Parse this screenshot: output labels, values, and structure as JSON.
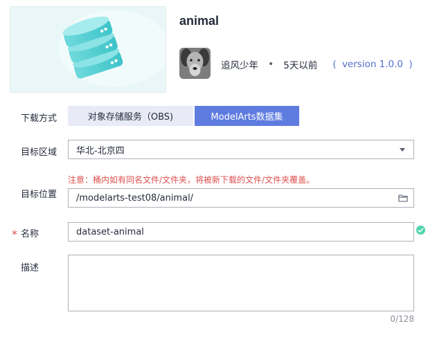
{
  "dataset": {
    "title": "animal",
    "author": "追风少年",
    "separator": "•",
    "time_ago": "5天以前",
    "version_open": "(",
    "version": "version 1.0.0",
    "version_close": ")"
  },
  "form": {
    "download_label": "下载方式",
    "download_options": [
      "对象存储服务（OBS)",
      "ModelArts数据集"
    ],
    "selected_option": "ModelArts数据集",
    "region_label": "目标区域",
    "region_value": "华北-北京四",
    "location_label": "目标位置",
    "warning": "注意：桶内如有同名文件/文件夹，将被新下载的文件/文件夹覆盖。",
    "location_value": "/modelarts-test08/animal/",
    "required_mark": "*",
    "name_label": "名称",
    "name_value": "dataset-animal",
    "desc_label": "描述",
    "desc_value": "",
    "desc_counter": "0/128"
  },
  "icons": {
    "thumbnail": "database-icon",
    "avatar": "dog-avatar",
    "region_caret": "caret-down-icon",
    "folder": "folder-icon",
    "valid": "check-circle-icon"
  },
  "colors": {
    "accent": "#5e7ce0",
    "tab_inactive": "#e8ebf7",
    "warning": "#de504e",
    "success": "#50d4ab",
    "link": "#526ecc"
  }
}
